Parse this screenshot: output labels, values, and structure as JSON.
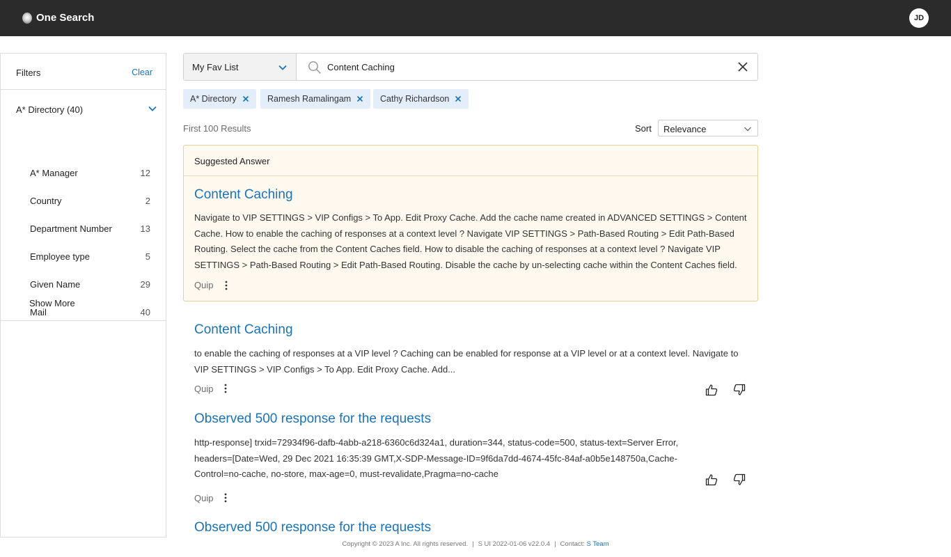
{
  "header": {
    "app_title": "One Search",
    "avatar_initials": "JD"
  },
  "filters": {
    "title": "Filters",
    "clear_label": "Clear",
    "group_title": "A* Directory (40)",
    "items": [
      {
        "label": "A* Manager",
        "count": "12"
      },
      {
        "label": "Country",
        "count": "2"
      },
      {
        "label": "Department Number",
        "count": "13"
      },
      {
        "label": "Employee type",
        "count": "5"
      },
      {
        "label": "Given Name",
        "count": "29"
      },
      {
        "label": "Mail",
        "count": "40"
      }
    ],
    "show_more_label": "Show More"
  },
  "search": {
    "scope_label": "My Fav List",
    "query": "Content Caching",
    "chips": [
      {
        "label": "A* Directory"
      },
      {
        "label": "Ramesh Ramalingam"
      },
      {
        "label": "Cathy Richardson"
      }
    ]
  },
  "results_meta": {
    "count_label": "First 100 Results",
    "sort_label": "Sort",
    "sort_value": "Relevance"
  },
  "suggested": {
    "header": "Suggested Answer",
    "title": "Content Caching",
    "snippet": "Navigate to VIP SETTINGS > VIP Configs > To App. Edit Proxy Cache. Add the cache name created in ADVANCED SETTINGS > Content Cache. How to enable the caching of responses at a context level ? Navigate VIP SETTINGS > Path-Based Routing > Edit Path-Based Routing. Select the cache from the Content Caches field. How to disable the caching of responses at a context level ? Navigate VIP SETTINGS > Path-Based Routing > Edit Path-Based Routing. Disable the cache by un-selecting cache within the Content Caches field.",
    "source": "Quip"
  },
  "results": [
    {
      "title": "Content Caching",
      "snippet": "to enable the caching of responses at a VIP level ? Caching can be enabled for response at a VIP level or at a context level. Navigate to VIP SETTINGS > VIP Configs > To App. Edit Proxy Cache. Add...",
      "source": "Quip"
    },
    {
      "title": "Observed 500 response for the requests",
      "snippet": "http-response] trxid=72934f96-dafb-4abb-a218-6360c6d324a1, duration=344, status-code=500, status-text=Server Error, headers=[Date=Wed, 29 Dec 2021 16:35:39 GMT,X-SDP-Message-ID=9f6da7dd-4674-45fc-84af-a0b5e148750a,Cache-Control=no-cache, no-store, max-age=0, must-revalidate,Pragma=no-cache",
      "source": "Quip"
    },
    {
      "title": "Observed 500 response for the requests"
    }
  ],
  "footer": {
    "copyright": "Copyright © 2023 A Inc. All rights reserved.",
    "version": "S UI 2022-01-06 v22.0.4",
    "contact_label": "Contact:",
    "contact_link": "S Team"
  },
  "colors": {
    "header_bg": "#2b2b2b",
    "link": "#1a73b8",
    "chip_bg": "#e4eefa",
    "suggested_bg": "#fff9ef",
    "suggested_border": "#e8cf9a"
  }
}
